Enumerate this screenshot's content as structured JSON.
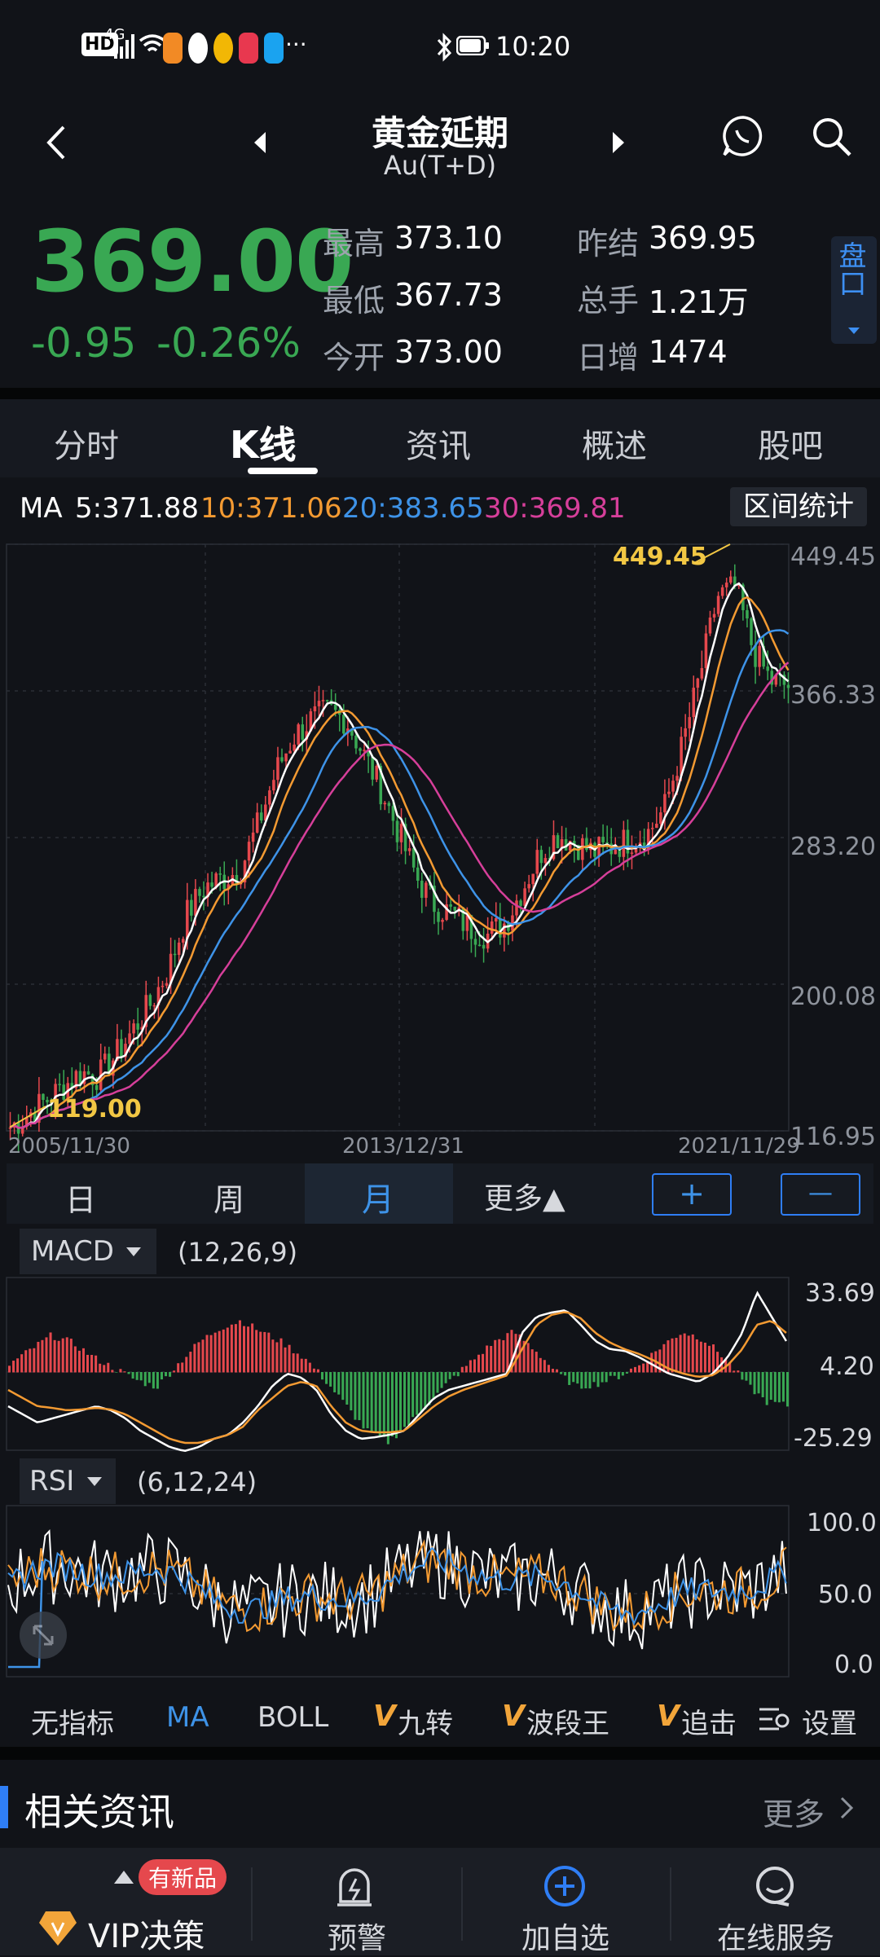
{
  "status_bar": {
    "time": "10:20",
    "network": "4G",
    "hd": "HD",
    "more": "···"
  },
  "header": {
    "title": "黄金延期",
    "subtitle": "Au(T+D)"
  },
  "quote": {
    "price": "369.00",
    "change": "-0.95",
    "change_pct": "-0.26%",
    "high_label": "最高",
    "high": "373.10",
    "low_label": "最低",
    "low": "367.73",
    "open_label": "今开",
    "open": "373.00",
    "prev_label": "昨结",
    "prev": "369.95",
    "vol_label": "总手",
    "vol": "1.21万",
    "inc_label": "日增",
    "inc": "1474",
    "side_tab": "盘口"
  },
  "tabs": [
    "分时",
    "K线",
    "资讯",
    "概述",
    "股吧"
  ],
  "active_tab": 1,
  "ma_bar": {
    "ma": "MA",
    "ma5": "5:371.88",
    "ma10": "10:371.06",
    "ma20": "20:383.65",
    "ma30": "30:369.81",
    "stats_button": "区间统计"
  },
  "colors": {
    "up": "#e5484d",
    "down": "#39a853",
    "ma5": "#ffffff",
    "ma10": "#f39a32",
    "ma20": "#3e93e8",
    "ma30": "#d63f9a",
    "accent": "#2f7ef5",
    "max_label": "#f2c744"
  },
  "chart_data": [
    {
      "type": "candlestick",
      "title": "K线 月",
      "y_ticks": [
        "449.45",
        "366.33",
        "283.20",
        "200.08",
        "116.95"
      ],
      "ylim": [
        116.95,
        449.45
      ],
      "x_ticks": [
        "2005/11/30",
        "2013/12/31",
        "2021/11/29"
      ],
      "max_marker": "449.45",
      "min_marker": "119.00",
      "ma_series_close": [
        119,
        126,
        134,
        142,
        150,
        148,
        160,
        175,
        190,
        210,
        240,
        255,
        260,
        265,
        290,
        320,
        340,
        350,
        355,
        350,
        330,
        310,
        285,
        260,
        245,
        240,
        232,
        228,
        235,
        255,
        275,
        285,
        280,
        275,
        278,
        282,
        285,
        300,
        335,
        375,
        420,
        425,
        390,
        372,
        369
      ],
      "grid": true
    },
    {
      "type": "bar",
      "title": "MACD",
      "params": "(12,26,9)",
      "y_ticks": [
        "33.69",
        "4.20",
        "-25.29"
      ],
      "ylim": [
        -25.29,
        33.69
      ]
    },
    {
      "type": "line",
      "title": "RSI",
      "params": "(6,12,24)",
      "y_ticks": [
        "100.0",
        "50.0",
        "0.0"
      ],
      "ylim": [
        0,
        100
      ]
    }
  ],
  "period_bar": {
    "items": [
      "日",
      "周",
      "月",
      "更多▲"
    ],
    "active": 2,
    "plus": "+",
    "minus": "—"
  },
  "indicators": {
    "items": [
      "无指标",
      "MA",
      "BOLL",
      "九转",
      "波段王",
      "追击",
      "设置"
    ],
    "v_prefix": "V"
  },
  "news": {
    "title": "相关资讯",
    "more": "更多"
  },
  "bottom_nav": {
    "vip": "VIP决策",
    "badge": "有新品",
    "alert": "预警",
    "add": "加自选",
    "service": "在线服务"
  }
}
